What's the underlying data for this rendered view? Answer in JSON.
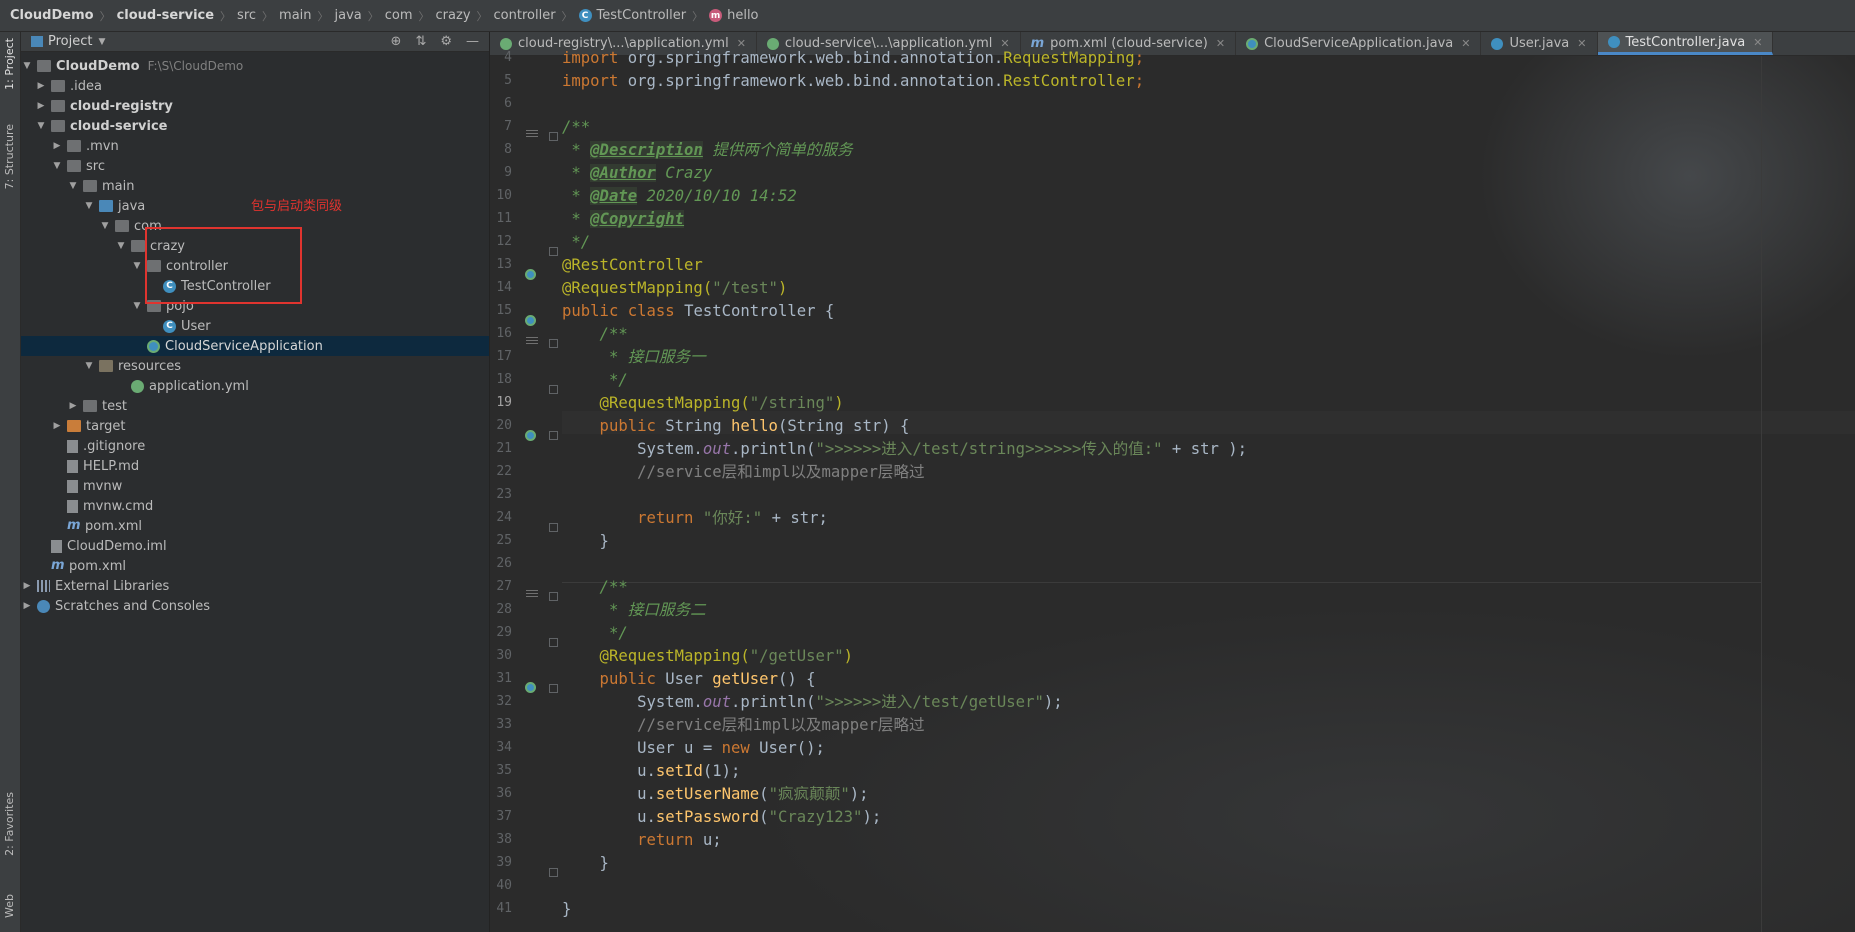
{
  "breadcrumb": {
    "items": [
      "CloudDemo",
      "cloud-service",
      "src",
      "main",
      "java",
      "com",
      "crazy",
      "controller",
      "TestController",
      "hello"
    ]
  },
  "toolstrip": {
    "project_tab": "1: Project",
    "structure_tab": "7: Structure",
    "favorites_tab": "2: Favorites",
    "web_tab": "Web"
  },
  "project_panel": {
    "title": "Project",
    "tree": [
      {
        "label": "CloudDemo",
        "path": "F:\\S\\CloudDemo"
      },
      {
        "label": ".idea"
      },
      {
        "label": "cloud-registry"
      },
      {
        "label": "cloud-service"
      },
      {
        "label": ".mvn"
      },
      {
        "label": "src"
      },
      {
        "label": "main"
      },
      {
        "label": "java"
      },
      {
        "label": "com"
      },
      {
        "label": "crazy"
      },
      {
        "label": "controller"
      },
      {
        "label": "TestController"
      },
      {
        "label": "pojo"
      },
      {
        "label": "User"
      },
      {
        "label": "CloudServiceApplication"
      },
      {
        "label": "resources"
      },
      {
        "label": "application.yml"
      },
      {
        "label": "test"
      },
      {
        "label": "target"
      },
      {
        "label": ".gitignore"
      },
      {
        "label": "HELP.md"
      },
      {
        "label": "mvnw"
      },
      {
        "label": "mvnw.cmd"
      },
      {
        "label": "pom.xml"
      },
      {
        "label": "CloudDemo.iml"
      },
      {
        "label": "pom.xml"
      },
      {
        "label": "External Libraries"
      },
      {
        "label": "Scratches and Consoles"
      }
    ],
    "annotation": "包与启动类同级"
  },
  "tabs": [
    {
      "label": "cloud-registry\\...\\application.yml"
    },
    {
      "label": "cloud-service\\...\\application.yml"
    },
    {
      "label": "pom.xml (cloud-service)"
    },
    {
      "label": "CloudServiceApplication.java"
    },
    {
      "label": "User.java"
    },
    {
      "label": "TestController.java"
    }
  ],
  "editor": {
    "line_numbers": [
      "4",
      "5",
      "6",
      "7",
      "8",
      "9",
      "10",
      "11",
      "12",
      "13",
      "14",
      "15",
      "16",
      "17",
      "18",
      "19",
      "20",
      "21",
      "22",
      "23",
      "24",
      "25",
      "26",
      "27",
      "28",
      "29",
      "30",
      "31",
      "32",
      "33",
      "34",
      "35",
      "36",
      "37",
      "38",
      "39",
      "40",
      "41"
    ],
    "code": {
      "l4a": "import ",
      "l4b": "org.springframework.web.bind.annotation.",
      "l4c": "RequestMapping",
      "l4d": ";",
      "l5a": "import ",
      "l5b": "org.springframework.web.bind.annotation.",
      "l5c": "RestController",
      "l5d": ";",
      "l7": "/**",
      "l8a": " * ",
      "l8b": "@Description",
      "l8c": " 提供两个简单的服务",
      "l9a": " * ",
      "l9b": "@Author",
      "l9c": " Crazy",
      "l10a": " * ",
      "l10b": "@Date",
      "l10c": " 2020/10/10 14:52",
      "l11a": " * ",
      "l11b": "@Copyright",
      "l12": " */",
      "l13": "@RestController",
      "l14a": "@RequestMapping(",
      "l14b": "\"/test\"",
      "l14c": ")",
      "l15a": "public class ",
      "l15b": "TestController {",
      "l16": "    /**",
      "l17": "     * 接口服务一",
      "l18": "     */",
      "l19a": "    @RequestMapping(",
      "l19b": "\"/string\"",
      "l19c": ")",
      "l20a": "    public ",
      "l20b": "String ",
      "l20c": "hello",
      "l20d": "(String str) {",
      "l21a": "        System.",
      "l21b": "out",
      "l21c": ".println(",
      "l21d": "\">>>>>>进入/test/string>>>>>>传入的值:\"",
      "l21e": " + str );",
      "l22": "        //service层和impl以及mapper层略过",
      "l24a": "        return ",
      "l24b": "\"你好:\"",
      "l24c": " + str;",
      "l25": "    }",
      "l27": "    /**",
      "l28": "     * 接口服务二",
      "l29": "     */",
      "l30a": "    @RequestMapping(",
      "l30b": "\"/getUser\"",
      "l30c": ")",
      "l31a": "    public ",
      "l31b": "User ",
      "l31c": "getUser",
      "l31d": "() {",
      "l32a": "        System.",
      "l32b": "out",
      "l32c": ".println(",
      "l32d": "\">>>>>>进入/test/getUser\"",
      "l32e": ");",
      "l33": "        //service层和impl以及mapper层略过",
      "l34a": "        User u = ",
      "l34b": "new ",
      "l34c": "User();",
      "l35a": "        u.",
      "l35b": "setId",
      "l35c": "(1);",
      "l36a": "        u.",
      "l36b": "setUserName",
      "l36c": "(",
      "l36d": "\"疯疯颠颠\"",
      "l36e": ");",
      "l37a": "        u.",
      "l37b": "setPassword",
      "l37c": "(",
      "l37d": "\"Crazy123\"",
      "l37e": ");",
      "l38a": "        return ",
      "l38b": "u;",
      "l39": "    }",
      "l41": "}"
    }
  },
  "colors": {
    "selection": "#0d293e",
    "annotation_red": "#e0342f",
    "active_tab_underline": "#4a88c7"
  }
}
